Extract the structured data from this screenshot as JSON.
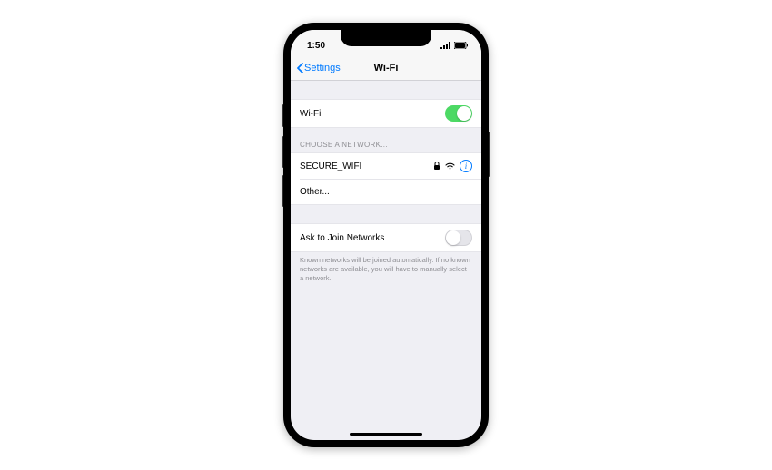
{
  "status_bar": {
    "time": "1:50"
  },
  "nav": {
    "back_label": "Settings",
    "title": "Wi-Fi"
  },
  "wifi_toggle": {
    "label": "Wi-Fi",
    "enabled": true
  },
  "choose_network": {
    "header": "CHOOSE A NETWORK...",
    "networks": [
      {
        "name": "SECURE_WIFI",
        "locked": true
      }
    ],
    "other_label": "Other..."
  },
  "ask_to_join": {
    "label": "Ask to Join Networks",
    "enabled": false,
    "footer": "Known networks will be joined automatically. If no known networks are available, you will have to manually select a network."
  }
}
